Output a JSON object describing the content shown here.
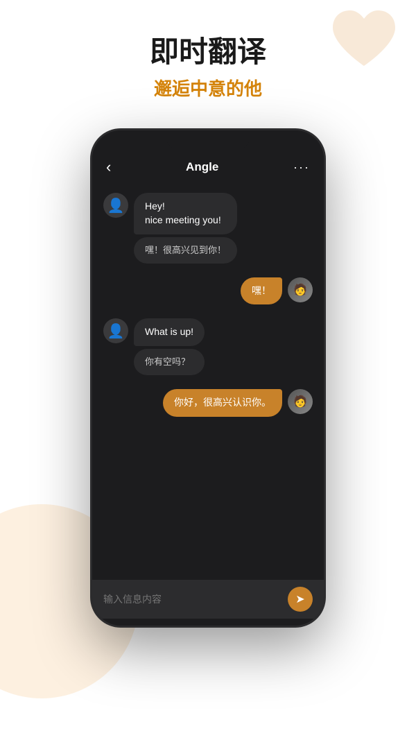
{
  "header": {
    "title_main": "即时翻译",
    "title_sub": "邂逅中意的他"
  },
  "chat": {
    "contact_name": "Angle",
    "back_icon": "‹",
    "more_icon": "···",
    "messages": [
      {
        "id": 1,
        "type": "received",
        "text": "Hey!\nnice meeting you!",
        "translation": "嘿！很高兴见到你！"
      },
      {
        "id": 2,
        "type": "sent",
        "text": "嘿！"
      },
      {
        "id": 3,
        "type": "received",
        "text": "What is up!",
        "translation": "你有空吗？"
      },
      {
        "id": 4,
        "type": "sent",
        "text": "你好，很高兴认识你。"
      }
    ],
    "input_placeholder": "输入信息内容"
  }
}
